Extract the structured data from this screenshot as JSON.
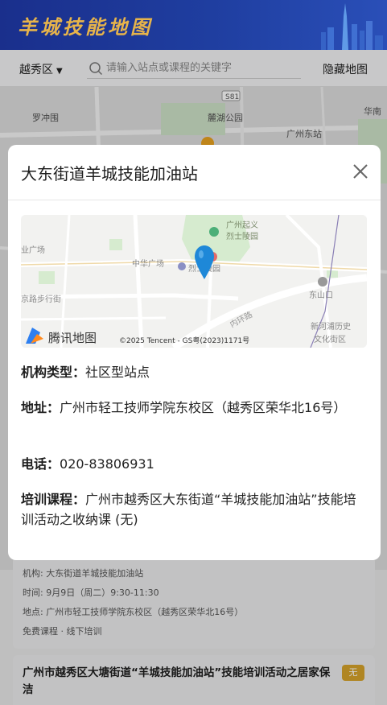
{
  "header": {
    "logo_text": "羊城技能地图"
  },
  "searchbar": {
    "district": "越秀区",
    "placeholder": "请输入站点或课程的关键字",
    "hide_map_label": "隐藏地图"
  },
  "background_map": {
    "labels": [
      "S81",
      "罗冲围",
      "麓湖公园",
      "广州东站",
      "华南"
    ]
  },
  "modal": {
    "title": "大东街道羊城技能加油站",
    "map": {
      "labels": [
        "广州起义",
        "烈士陵园",
        "业广场",
        "中华广场",
        "烈士陵园",
        "京路步行街",
        "东山口",
        "内环路",
        "新河浦历史",
        "文化街区"
      ],
      "brand": "腾讯地图",
      "copyright": "©2025 Tencent - GS粤(2023)1171号"
    },
    "org_type_label": "机构类型：",
    "org_type_value": "社区型站点",
    "address_label": "地址：",
    "address_value": "广州市轻工技师学院东校区（越秀区荣华北16号）",
    "phone_label": "电话：",
    "phone_value": "020-83806931",
    "course_label": "培训课程：",
    "course_value": "广州市越秀区大东街道“羊城技能加油站”技能培训活动之收纳课 (无)"
  },
  "list": {
    "card1": {
      "org": "机构: 大东街道羊城技能加油站",
      "time": "时间: 9月9日（周二）9:30-11:30",
      "place": "地点: 广州市轻工技师学院东校区（越秀区荣华北16号）",
      "tags": "免费课程 · 线下培训"
    },
    "card2": {
      "title": "广州市越秀区大塘街道“羊城技能加油站”技能培训活动之居家保洁",
      "badge": "无"
    }
  },
  "colors": {
    "header_bg": "#1f3ea0",
    "logo_gold": "#e7b44a",
    "badge_gold": "#d7a42b",
    "marker_blue": "#1e88d8"
  }
}
